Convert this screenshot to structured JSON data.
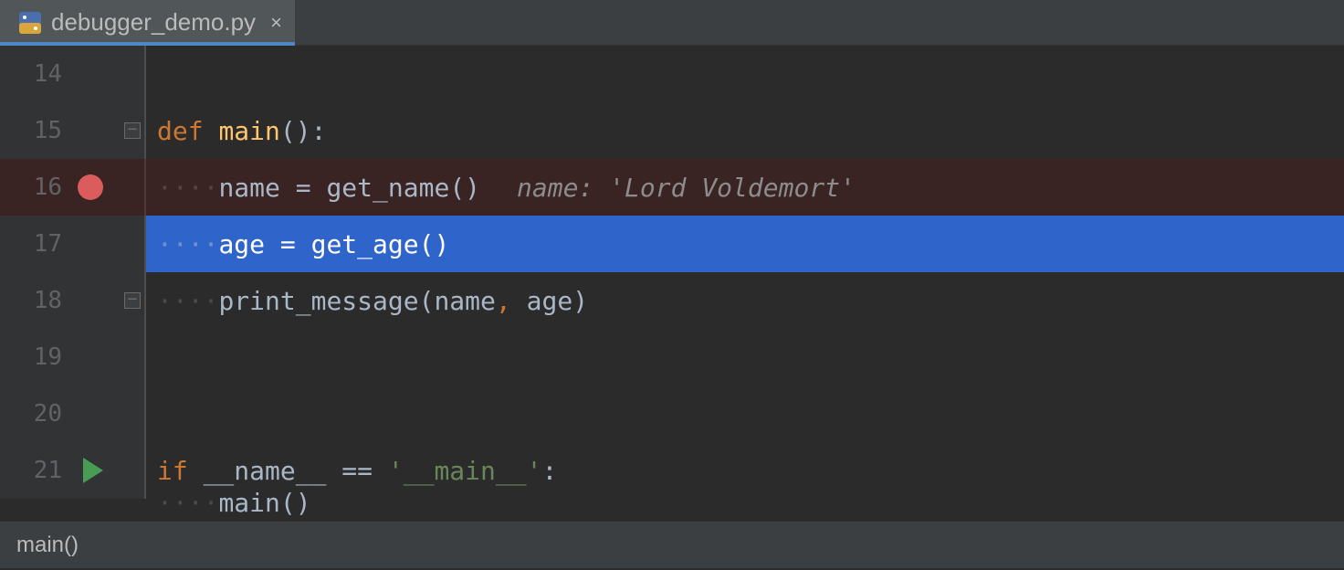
{
  "tab": {
    "filename": "debugger_demo.py"
  },
  "lines": [
    {
      "num": "14"
    },
    {
      "num": "15"
    },
    {
      "num": "16"
    },
    {
      "num": "17"
    },
    {
      "num": "18"
    },
    {
      "num": "19"
    },
    {
      "num": "20"
    },
    {
      "num": "21"
    }
  ],
  "code": {
    "l15_def": "def",
    "l15_fn": "main",
    "l15_paren": "():",
    "l16_lhs": "name",
    "l16_eq": " = ",
    "l16_rhs": "get_name",
    "l16_paren": "()",
    "l16_hint": "name: 'Lord Voldemort'",
    "l17_lhs": "age",
    "l17_eq": " = ",
    "l17_rhs": "get_age",
    "l17_paren": "()",
    "l18_fn": "print_message",
    "l18_open": "(",
    "l18_a1": "name",
    "l18_comma": ",",
    "l18_sp": " ",
    "l18_a2": "age",
    "l18_close": ")",
    "l21_if": "if",
    "l21_name": "__name__",
    "l21_eq": " == ",
    "l21_str": "'__main__'",
    "l21_colon": ":",
    "l22_main": "main",
    "l22_paren": "()"
  },
  "breadcrumb": "main()"
}
